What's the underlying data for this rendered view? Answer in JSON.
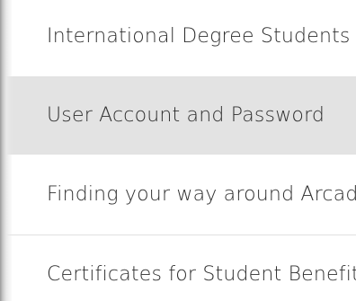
{
  "menu": {
    "items": [
      {
        "label": "International Degree Students"
      },
      {
        "label": "User Account and Password"
      },
      {
        "label": "Finding your way around Arcada"
      },
      {
        "label": "Certificates for Student Benefits"
      }
    ]
  }
}
